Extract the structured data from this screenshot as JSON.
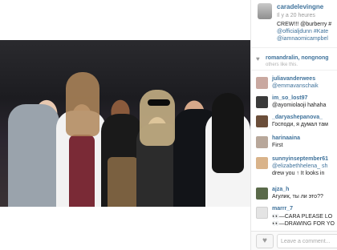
{
  "post": {
    "owner": "caradelevingne",
    "time": "Il y a 20 heures",
    "caption_line1": "CREW!!! @burberry #",
    "caption_line2": "@officialjdunn #Kate",
    "caption_line3": "@iamnaomicampbel"
  },
  "likes": {
    "text": "romandralin, nongnong",
    "more": "others like this."
  },
  "comments": [
    {
      "user": "juliavanderwees",
      "text": "@emmavanschaik",
      "color": "#c9a8a0"
    },
    {
      "user": "im_so_lost97",
      "text": "@ayomiolaoji hahaha",
      "color": "#3a3a3a"
    },
    {
      "user": "_daryashepanova_",
      "text": "Господи, я думал там",
      "color": "#6b4e3a"
    },
    {
      "user": "harinaaina",
      "text": "First",
      "color": "#b8a79a"
    },
    {
      "user": "sunnyinseptember61",
      "text": "@elizabethhelena_ sh",
      "text2": "drew you ↑ It looks in",
      "color": "#d9b38a"
    },
    {
      "user": "ajza_h",
      "text": "Агулик, ты ли это??",
      "color": "#5a6a4a"
    },
    {
      "user": "marrr_7",
      "text": "👀—CARA PLEASE LO",
      "text2": "👀—DRAWING FOR YO",
      "color": "#e4e4e4"
    }
  ],
  "footer": {
    "like_icon": "heart-icon",
    "comment_placeholder": "Leave a comment..."
  },
  "colors": {
    "link": "#3f729b",
    "meta": "#9a9a9a"
  }
}
